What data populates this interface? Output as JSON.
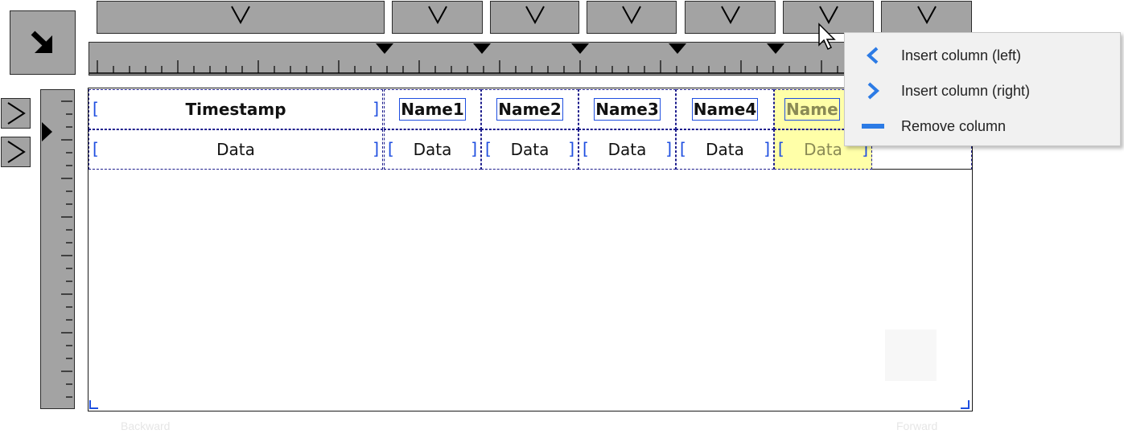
{
  "table": {
    "headers": [
      "Timestamp",
      "Name1",
      "Name2",
      "Name3",
      "Name4",
      "Name"
    ],
    "row": [
      "Data",
      "Data",
      "Data",
      "Data",
      "Data",
      "Data"
    ]
  },
  "context_menu": {
    "items": [
      {
        "label": "Insert column (left)",
        "icon": "chevron-left-icon"
      },
      {
        "label": "Insert column (right)",
        "icon": "chevron-right-icon"
      },
      {
        "label": "Remove column",
        "icon": "minus-icon"
      }
    ]
  },
  "footer": {
    "backward": "Backward",
    "forward": "Forward"
  },
  "colors": {
    "accent": "#2c7be5",
    "highlight": "#ffffa8",
    "border": "#1b1b8c"
  }
}
